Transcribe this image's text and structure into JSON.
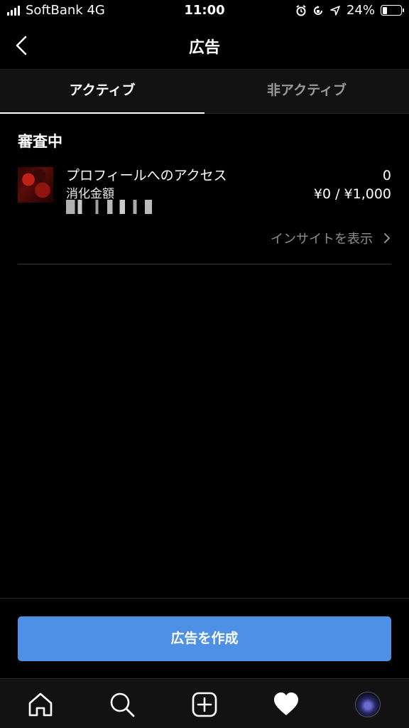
{
  "status_bar": {
    "carrier": "SoftBank 4G",
    "time": "11:00",
    "battery": "24%"
  },
  "nav": {
    "title": "広告",
    "back_icon": "chevron-left-icon"
  },
  "tabs": [
    {
      "label": "アクティブ",
      "active": true
    },
    {
      "label": "非アクティブ",
      "active": false
    }
  ],
  "section": {
    "title": "審査中"
  },
  "ad": {
    "title": "プロフィールへのアクセス",
    "sub_label": "消化金額",
    "count": "0",
    "budget": "¥0 / ¥1,000",
    "insight_link": "インサイトを表示"
  },
  "create_button": {
    "label": "広告を作成",
    "color": "#4d90e6"
  },
  "tab_bar": {
    "icons": [
      "home-icon",
      "search-icon",
      "add-post-icon",
      "heart-icon",
      "profile-avatar"
    ]
  }
}
